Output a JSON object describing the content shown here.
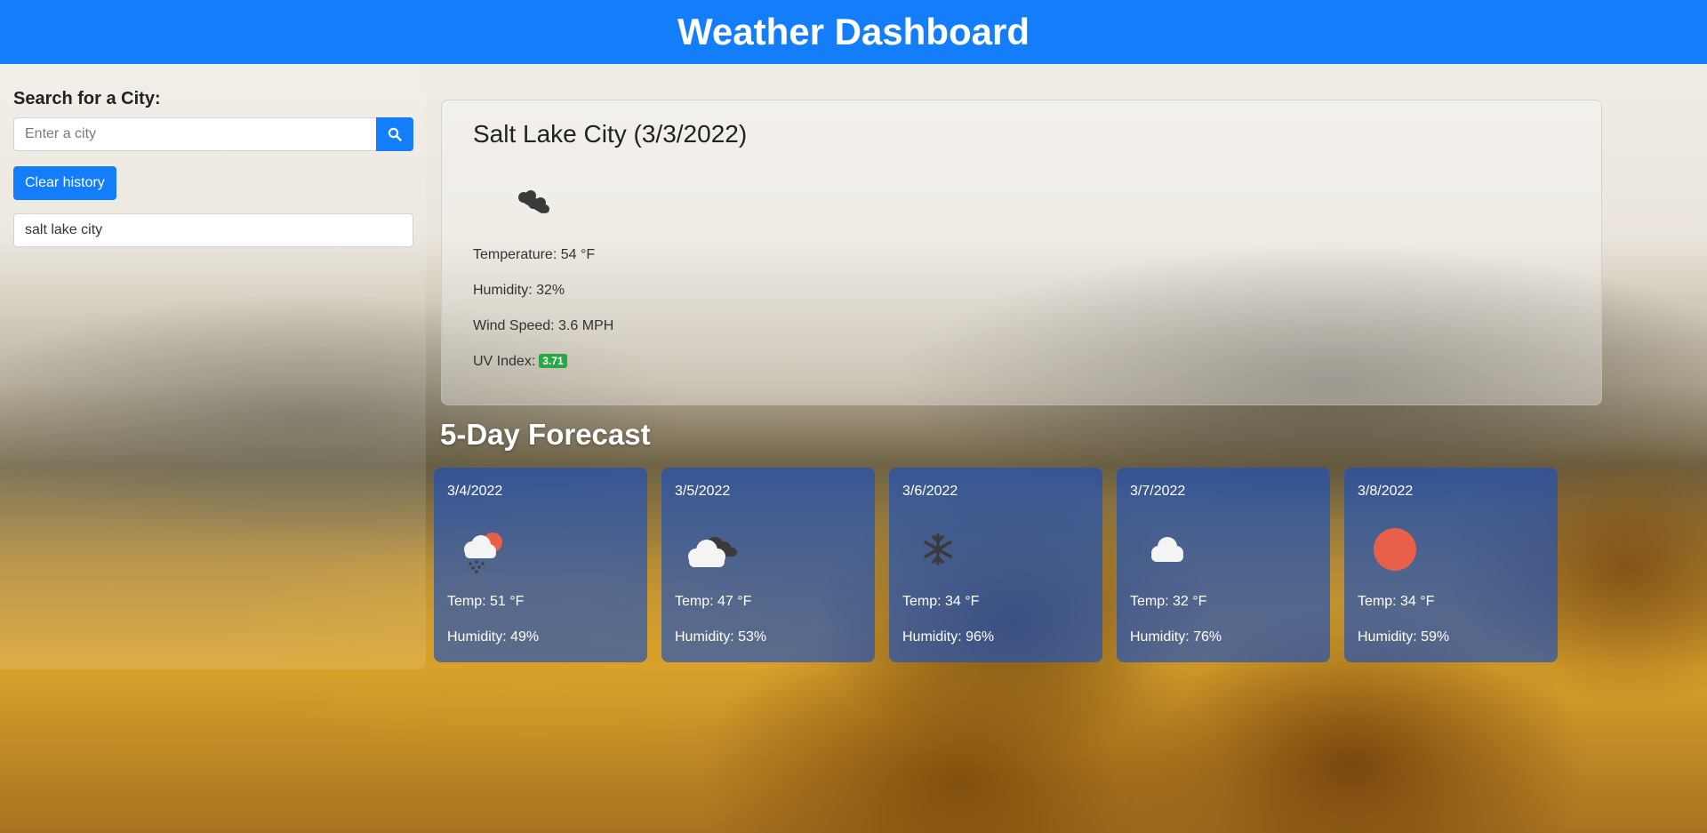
{
  "header": {
    "title": "Weather Dashboard"
  },
  "search": {
    "label": "Search for a City:",
    "placeholder": "Enter a city",
    "value": "",
    "button_icon": "search-icon",
    "clear_label": "Clear history"
  },
  "history": [
    "salt lake city"
  ],
  "current": {
    "city_title": "Salt Lake City (3/3/2022)",
    "icon": "broken-clouds-icon",
    "temperature": "Temperature: 54 °F",
    "humidity": "Humidity: 32%",
    "wind": "Wind Speed: 3.6 MPH",
    "uv_label": "UV Index:",
    "uv_value": "3.71",
    "uv_color": "#28a745"
  },
  "forecast": {
    "title": "5-Day Forecast",
    "days": [
      {
        "date": "3/4/2022",
        "icon": "rain-sun-icon",
        "temp": "Temp: 51 °F",
        "humidity": "Humidity: 49%"
      },
      {
        "date": "3/5/2022",
        "icon": "overcast-clouds-icon",
        "temp": "Temp: 47 °F",
        "humidity": "Humidity: 53%"
      },
      {
        "date": "3/6/2022",
        "icon": "snow-icon",
        "temp": "Temp: 34 °F",
        "humidity": "Humidity: 96%"
      },
      {
        "date": "3/7/2022",
        "icon": "cloud-icon",
        "temp": "Temp: 32 °F",
        "humidity": "Humidity: 76%"
      },
      {
        "date": "3/8/2022",
        "icon": "sun-icon",
        "temp": "Temp: 34 °F",
        "humidity": "Humidity: 59%"
      }
    ]
  },
  "colors": {
    "primary": "#147dfa",
    "uv_good": "#28a745",
    "sun": "#e8604a"
  }
}
